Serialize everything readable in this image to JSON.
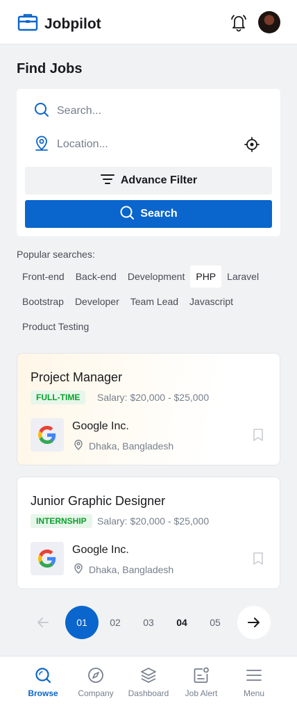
{
  "header": {
    "app_name": "Jobpilot",
    "logo_icon": "briefcase-icon",
    "notification_icon": "bell-icon",
    "accent_color": "#0a65cc"
  },
  "page": {
    "title": "Find Jobs"
  },
  "search": {
    "keyword_placeholder": "Search...",
    "keyword_value": "",
    "location_placeholder": "Location...",
    "location_value": "",
    "filter_label": "Advance Filter",
    "search_label": "Search"
  },
  "popular": {
    "label": "Popular searches:",
    "tags": [
      "Front-end",
      "Back-end",
      "Development",
      "PHP",
      "Laravel",
      "Bootstrap",
      "Developer",
      "Team Lead",
      "Javascript",
      "Product Testing"
    ],
    "active_tag": "PHP"
  },
  "jobs": [
    {
      "title": "Project Manager",
      "type": "FULL-TIME",
      "salary": "Salary: $20,000 - $25,000",
      "company": "Google Inc.",
      "location": "Dhaka, Bangladesh",
      "featured": true
    },
    {
      "title": "Junior Graphic Designer",
      "type": "INTERNSHIP",
      "salary": "Salary: $20,000 - $25,000",
      "company": "Google Inc.",
      "location": "Dhaka, Bangladesh",
      "featured": false
    }
  ],
  "pagination": {
    "pages": [
      "01",
      "02",
      "03",
      "04",
      "05"
    ],
    "current": "01"
  },
  "bottom_nav": [
    {
      "label": "Browse",
      "icon": "browse-icon",
      "active": true
    },
    {
      "label": "Company",
      "icon": "compass-icon",
      "active": false
    },
    {
      "label": "Dashboard",
      "icon": "layers-icon",
      "active": false
    },
    {
      "label": "Job Alert",
      "icon": "job-alert-icon",
      "active": false
    },
    {
      "label": "Menu",
      "icon": "menu-icon",
      "active": false
    }
  ]
}
